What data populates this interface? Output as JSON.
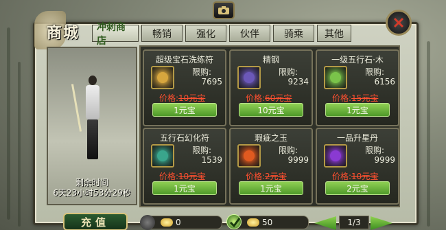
{
  "panel": {
    "title": "商城"
  },
  "tabs": [
    {
      "label": "冲刺商店",
      "active": true
    },
    {
      "label": "畅销",
      "active": false
    },
    {
      "label": "强化",
      "active": false
    },
    {
      "label": "伙伴",
      "active": false
    },
    {
      "label": "骑乘",
      "active": false
    },
    {
      "label": "其他",
      "active": false
    }
  ],
  "preview": {
    "timer_label": "剩余时间",
    "timer_value": "6天23小时53分29秒"
  },
  "items": [
    {
      "name": "超级宝石洗练符",
      "limit_label": "限购:",
      "limit": "7695",
      "price_label": "价格:",
      "price_old": "10元宝",
      "button": "1元宝",
      "icon": "gem-wash-talisman-icon",
      "icon_color": "#d7a63e"
    },
    {
      "name": "精钢",
      "limit_label": "限购:",
      "limit": "9234",
      "price_label": "价格:",
      "price_old": "60元宝",
      "button": "10元宝",
      "icon": "refined-steel-icon",
      "icon_color": "#6b58b8"
    },
    {
      "name": "一级五行石·木",
      "limit_label": "限购:",
      "limit": "6156",
      "price_label": "价格:",
      "price_old": "15元宝",
      "button": "1元宝",
      "icon": "wood-element-stone-icon",
      "icon_color": "#7ac34a"
    },
    {
      "name": "五行石幻化符",
      "limit_label": "限购:",
      "limit": "1539",
      "price_label": "价格:",
      "price_old": "10元宝",
      "button": "1元宝",
      "icon": "element-transform-talisman-icon",
      "icon_color": "#3aa58c"
    },
    {
      "name": "瑕疵之玉",
      "limit_label": "限购:",
      "limit": "9999",
      "price_label": "价格:",
      "price_old": "2元宝",
      "button": "1元宝",
      "icon": "flawed-jade-icon",
      "icon_color": "#e05a20"
    },
    {
      "name": "一品升星丹",
      "limit_label": "限购:",
      "limit": "9999",
      "price_label": "价格:",
      "price_old": "10元宝",
      "button": "2元宝",
      "icon": "star-pill-icon",
      "icon_color": "#8a3ad2"
    }
  ],
  "footer": {
    "recharge_label": "充值",
    "currency_a": "0",
    "currency_b": "50",
    "page": "1/3"
  },
  "colors": {
    "price": "#ff5030",
    "button": "#5fae35"
  }
}
